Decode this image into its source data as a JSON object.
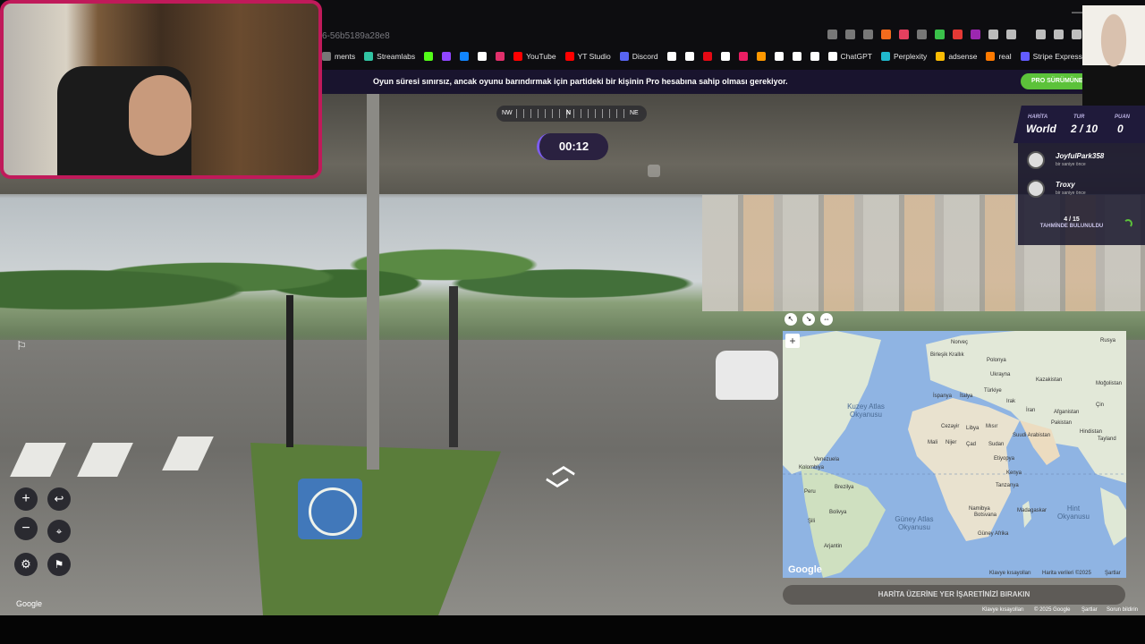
{
  "browser": {
    "url_fragment": "6-56b5189a28e8",
    "bookmarks": [
      {
        "label": "ments",
        "color": "#777777"
      },
      {
        "label": "Streamlabs",
        "color": "#31c3a2"
      },
      {
        "label": "",
        "color": "#53fc18"
      },
      {
        "label": "",
        "color": "#9146ff"
      },
      {
        "label": "",
        "color": "#1185fe"
      },
      {
        "label": "",
        "color": "#ffffff"
      },
      {
        "label": "",
        "color": "#e1306c"
      },
      {
        "label": "YouTube",
        "color": "#ff0000"
      },
      {
        "label": "YT Studio",
        "color": "#ff0000"
      },
      {
        "label": "Discord",
        "color": "#5865f2"
      },
      {
        "label": "",
        "color": "#ffffff"
      },
      {
        "label": "",
        "color": "#ffffff"
      },
      {
        "label": "",
        "color": "#e50914"
      },
      {
        "label": "",
        "color": "#ffffff"
      },
      {
        "label": "",
        "color": "#e91e63"
      },
      {
        "label": "",
        "color": "#ff9800"
      },
      {
        "label": "",
        "color": "#ffffff"
      },
      {
        "label": "",
        "color": "#ffffff"
      },
      {
        "label": "",
        "color": "#ffffff"
      },
      {
        "label": "ChatGPT",
        "color": "#ffffff"
      },
      {
        "label": "Perplexity",
        "color": "#20b8cd"
      },
      {
        "label": "adsense",
        "color": "#fbbc04"
      },
      {
        "label": "real",
        "color": "#ff7a00"
      },
      {
        "label": "Stripe Express",
        "color": "#635bff"
      }
    ]
  },
  "banner": {
    "message": "Oyun süresi sınırsız, ancak oyunu barındırmak için partideki bir kişinin Pro hesabına sahip olması gerekiyor.",
    "pro_button": "PRO SÜRÜMÜNE"
  },
  "compass": {
    "left": "NW",
    "center": "N",
    "right": "NE"
  },
  "timer": "00:12",
  "score": {
    "map_label": "HARİTA",
    "map_value": "World",
    "round_label": "TUR",
    "round_value": "2 / 10",
    "points_label": "PUAN",
    "points_value": "0"
  },
  "players": [
    {
      "name": "JoyfulPark358",
      "status": "bir saniye önce"
    },
    {
      "name": "Troxy",
      "status": "bir saniye önce"
    }
  ],
  "guesses": {
    "count": "4 / 15",
    "label": "TAHMİNDE BULUNULDU"
  },
  "map": {
    "labels": [
      "Rusya",
      "Norveç",
      "Birleşik Krallık",
      "Polonya",
      "Ukrayna",
      "Kazakistan",
      "Moğolistan",
      "İspanya",
      "İtalya",
      "Türkiye",
      "Çin",
      "Irak",
      "İran",
      "Afganistan",
      "Pakistan",
      "Cezayir",
      "Libya",
      "Mısır",
      "Suudi Arabistan",
      "Hindistan",
      "Tayland",
      "Mali",
      "Nijer",
      "Çad",
      "Sudan",
      "Etiyopya",
      "Kolombiya",
      "Venezuela",
      "Peru",
      "Brezilya",
      "Kenya",
      "Tanzanya",
      "Bolivya",
      "Şili",
      "Arjantin",
      "Namibya",
      "Botsvana",
      "Madagaskar",
      "Güney Afrika"
    ],
    "oceans": {
      "north_atlantic": "Kuzey Atlas Okyanusu",
      "south_atlantic": "Güney Atlas Okyanusu",
      "indian": "Hint Okyanusu"
    },
    "footer": {
      "shortcuts": "Klavye kısayolları",
      "data": "Harita verileri ©2025",
      "terms": "Şartlar"
    },
    "google": "Google",
    "place_button": "HARİTA ÜZERİNE YER İŞARETİNİZİ BIRAKIN"
  },
  "sv_footer": {
    "google": "Google",
    "shortcuts": "Klavye kısayolları",
    "copyright": "© 2025 Google",
    "terms": "Şartlar",
    "report": "Sorun bildirin"
  },
  "controls": {
    "zoom_in": "+",
    "zoom_out": "−"
  }
}
